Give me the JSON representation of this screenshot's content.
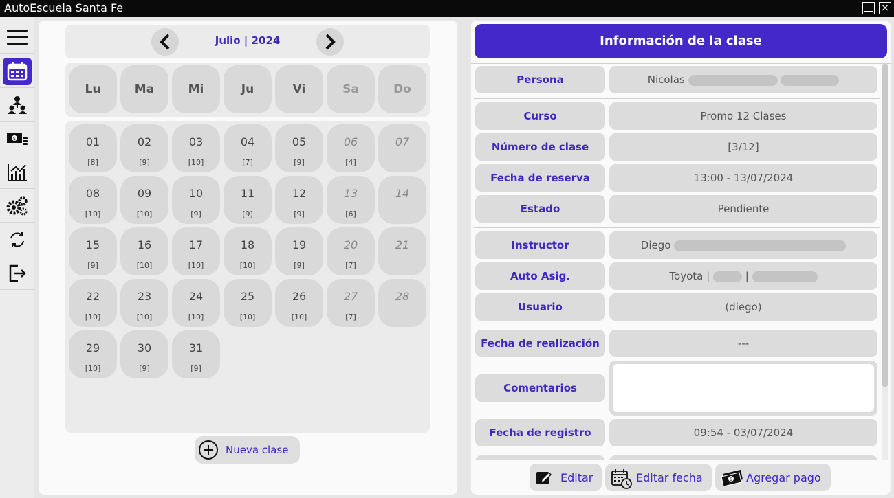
{
  "window": {
    "title": "AutoEscuela Santa Fe",
    "close_glyph": "×"
  },
  "sidebar": {
    "items": [
      {
        "name": "menu",
        "icon": "hamburger-menu-icon"
      },
      {
        "name": "calendar",
        "icon": "calendar-icon",
        "active": true
      },
      {
        "name": "people",
        "icon": "people-hierarchy-icon"
      },
      {
        "name": "payments",
        "icon": "money-icon"
      },
      {
        "name": "stats",
        "icon": "bar-chart-icon"
      },
      {
        "name": "settings",
        "icon": "gears-icon"
      },
      {
        "name": "sync",
        "icon": "sync-icon"
      },
      {
        "name": "logout",
        "icon": "logout-icon"
      }
    ]
  },
  "calendar": {
    "month_label": "Julio | 2024",
    "weekdays": [
      "Lu",
      "Ma",
      "Mi",
      "Ju",
      "Vi",
      "Sa",
      "Do"
    ],
    "days": [
      {
        "num": "01",
        "count": "[8]"
      },
      {
        "num": "02",
        "count": "[9]"
      },
      {
        "num": "03",
        "count": "[10]"
      },
      {
        "num": "04",
        "count": "[7]"
      },
      {
        "num": "05",
        "count": "[9]"
      },
      {
        "num": "06",
        "count": "[4]"
      },
      {
        "num": "07",
        "count": ""
      },
      {
        "num": "08",
        "count": "[10]"
      },
      {
        "num": "09",
        "count": "[10]"
      },
      {
        "num": "10",
        "count": "[9]"
      },
      {
        "num": "11",
        "count": "[9]"
      },
      {
        "num": "12",
        "count": "[9]"
      },
      {
        "num": "13",
        "count": "[6]"
      },
      {
        "num": "14",
        "count": ""
      },
      {
        "num": "15",
        "count": "[9]"
      },
      {
        "num": "16",
        "count": "[10]"
      },
      {
        "num": "17",
        "count": "[10]"
      },
      {
        "num": "18",
        "count": "[10]"
      },
      {
        "num": "19",
        "count": "[9]"
      },
      {
        "num": "20",
        "count": "[7]"
      },
      {
        "num": "21",
        "count": ""
      },
      {
        "num": "22",
        "count": "[10]"
      },
      {
        "num": "23",
        "count": "[10]"
      },
      {
        "num": "24",
        "count": "[10]"
      },
      {
        "num": "25",
        "count": "[10]"
      },
      {
        "num": "26",
        "count": "[10]"
      },
      {
        "num": "27",
        "count": "[7]"
      },
      {
        "num": "28",
        "count": ""
      },
      {
        "num": "29",
        "count": "[10]"
      },
      {
        "num": "30",
        "count": "[9]"
      },
      {
        "num": "31",
        "count": "[9]"
      }
    ],
    "new_class_label": "Nueva clase"
  },
  "info": {
    "header": "Información de la clase",
    "persona": {
      "label": "Persona",
      "value": "Nicolas"
    },
    "curso": {
      "label": "Curso",
      "value": "Promo 12 Clases"
    },
    "numero": {
      "label": "Número de clase",
      "value": "[3/12]"
    },
    "reserva": {
      "label": "Fecha de reserva",
      "value": "13:00 - 13/07/2024"
    },
    "estado": {
      "label": "Estado",
      "value": "Pendiente"
    },
    "instructor": {
      "label": "Instructor",
      "value": "Diego"
    },
    "auto": {
      "label": "Auto Asig.",
      "value": "Toyota |",
      "sep": "|"
    },
    "usuario": {
      "label": "Usuario",
      "value": "(diego)"
    },
    "realizacion": {
      "label": "Fecha de realización",
      "value": "---"
    },
    "comentarios": {
      "label": "Comentarios",
      "value": ""
    },
    "registro": {
      "label": "Fecha de registro",
      "value": "09:54 - 03/07/2024"
    }
  },
  "actions": {
    "edit": "Editar",
    "edit_date": "Editar fecha",
    "add_payment": "Agregar pago"
  },
  "colors": {
    "accent": "#4428c9",
    "panel": "#fafafa",
    "tile": "#d9d9d9"
  }
}
